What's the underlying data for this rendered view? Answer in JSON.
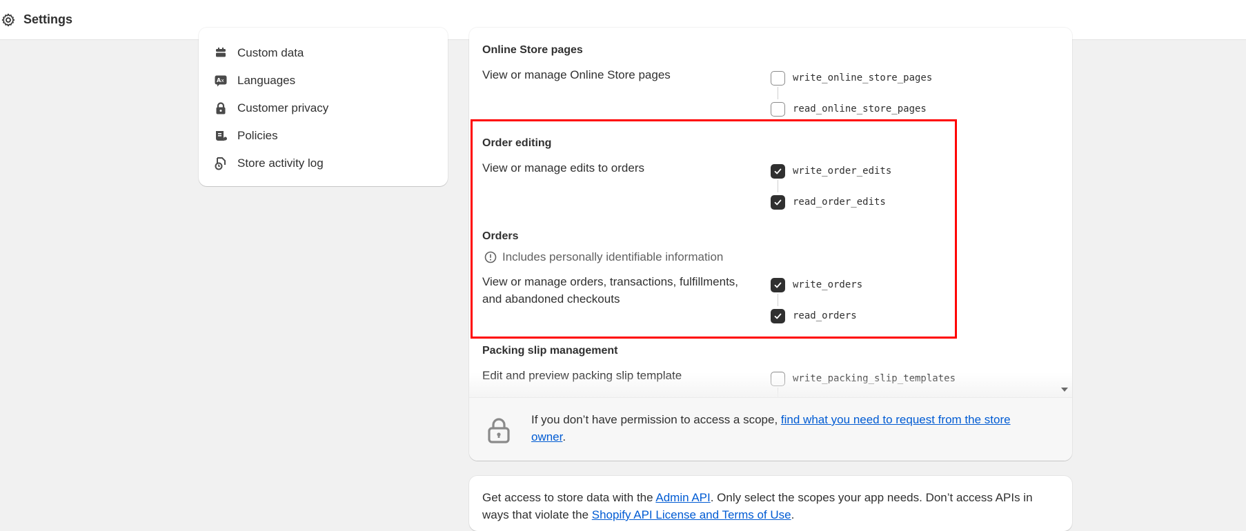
{
  "header": {
    "title": "Settings",
    "icon": "gear-icon"
  },
  "sidebar": {
    "items": [
      {
        "label": "Custom data",
        "icon": "database-icon"
      },
      {
        "label": "Languages",
        "icon": "translate-icon"
      },
      {
        "label": "Customer privacy",
        "icon": "lock-icon"
      },
      {
        "label": "Policies",
        "icon": "scroll-icon"
      },
      {
        "label": "Store activity log",
        "icon": "activity-log-icon"
      }
    ]
  },
  "scopes": {
    "online_store_pages": {
      "title": "Online Store pages",
      "description": "View or manage Online Store pages",
      "write": {
        "label": "write_online_store_pages",
        "checked": false
      },
      "read": {
        "label": "read_online_store_pages",
        "checked": false
      }
    },
    "order_editing": {
      "title": "Order editing",
      "description": "View or manage edits to orders",
      "write": {
        "label": "write_order_edits",
        "checked": true
      },
      "read": {
        "label": "read_order_edits",
        "checked": true
      }
    },
    "orders": {
      "title": "Orders",
      "pii_note": "Includes personally identifiable information",
      "description_line1": "View or manage orders, transactions, fulfillments,",
      "description_line2": "and abandoned checkouts",
      "write": {
        "label": "write_orders",
        "checked": true
      },
      "read": {
        "label": "read_orders",
        "checked": true
      }
    },
    "packing_slip": {
      "title": "Packing slip management",
      "description": "Edit and preview packing slip template",
      "write": {
        "label": "write_packing_slip_templates",
        "checked": false
      }
    }
  },
  "notice": {
    "text_before": "If you don’t have permission to access a scope, ",
    "link": "find what you need to request from the store owner",
    "text_after": "."
  },
  "api_info": {
    "text_before": "Get access to store data with the ",
    "link1": "Admin API",
    "text_middle": ". Only select the scopes your app needs. Don’t access APIs in ways that violate the ",
    "link2": "Shopify API License and Terms of Use",
    "text_after": "."
  },
  "colors": {
    "accent_link": "#005bd3",
    "highlight": "#ff0000",
    "checked": "#303030"
  }
}
